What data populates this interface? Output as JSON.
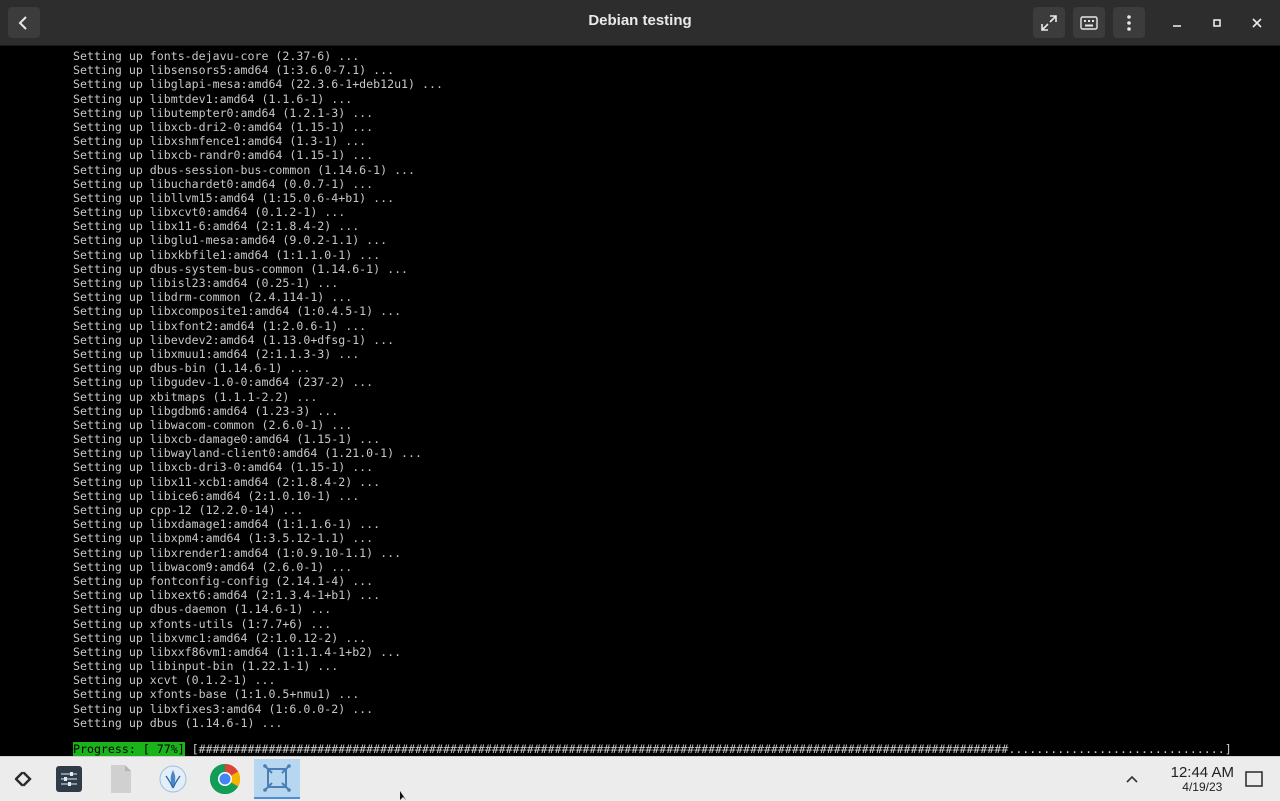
{
  "window": {
    "title": "Debian testing"
  },
  "terminal": {
    "lines": [
      "Setting up fonts-dejavu-core (2.37-6) ...",
      "Setting up libsensors5:amd64 (1:3.6.0-7.1) ...",
      "Setting up libglapi-mesa:amd64 (22.3.6-1+deb12u1) ...",
      "Setting up libmtdev1:amd64 (1.1.6-1) ...",
      "Setting up libutempter0:amd64 (1.2.1-3) ...",
      "Setting up libxcb-dri2-0:amd64 (1.15-1) ...",
      "Setting up libxshmfence1:amd64 (1.3-1) ...",
      "Setting up libxcb-randr0:amd64 (1.15-1) ...",
      "Setting up dbus-session-bus-common (1.14.6-1) ...",
      "Setting up libuchardet0:amd64 (0.0.7-1) ...",
      "Setting up libllvm15:amd64 (1:15.0.6-4+b1) ...",
      "Setting up libxcvt0:amd64 (0.1.2-1) ...",
      "Setting up libx11-6:amd64 (2:1.8.4-2) ...",
      "Setting up libglu1-mesa:amd64 (9.0.2-1.1) ...",
      "Setting up libxkbfile1:amd64 (1:1.1.0-1) ...",
      "Setting up dbus-system-bus-common (1.14.6-1) ...",
      "Setting up libisl23:amd64 (0.25-1) ...",
      "Setting up libdrm-common (2.4.114-1) ...",
      "Setting up libxcomposite1:amd64 (1:0.4.5-1) ...",
      "Setting up libxfont2:amd64 (1:2.0.6-1) ...",
      "Setting up libevdev2:amd64 (1.13.0+dfsg-1) ...",
      "Setting up libxmuu1:amd64 (2:1.1.3-3) ...",
      "Setting up dbus-bin (1.14.6-1) ...",
      "Setting up libgudev-1.0-0:amd64 (237-2) ...",
      "Setting up xbitmaps (1.1.1-2.2) ...",
      "Setting up libgdbm6:amd64 (1.23-3) ...",
      "Setting up libwacom-common (2.6.0-1) ...",
      "Setting up libxcb-damage0:amd64 (1.15-1) ...",
      "Setting up libwayland-client0:amd64 (1.21.0-1) ...",
      "Setting up libxcb-dri3-0:amd64 (1.15-1) ...",
      "Setting up libx11-xcb1:amd64 (2:1.8.4-2) ...",
      "Setting up libice6:amd64 (2:1.0.10-1) ...",
      "Setting up cpp-12 (12.2.0-14) ...",
      "Setting up libxdamage1:amd64 (1:1.1.6-1) ...",
      "Setting up libxpm4:amd64 (1:3.5.12-1.1) ...",
      "Setting up libxrender1:amd64 (1:0.9.10-1.1) ...",
      "Setting up libwacom9:amd64 (2.6.0-1) ...",
      "Setting up fontconfig-config (2.14.1-4) ...",
      "Setting up libxext6:amd64 (2:1.3.4-1+b1) ...",
      "Setting up dbus-daemon (1.14.6-1) ...",
      "Setting up xfonts-utils (1:7.7+6) ...",
      "Setting up libxvmc1:amd64 (2:1.0.12-2) ...",
      "Setting up libxxf86vm1:amd64 (1:1.1.4-1+b2) ...",
      "Setting up libinput-bin (1.22.1-1) ...",
      "Setting up xcvt (0.1.2-1) ...",
      "Setting up xfonts-base (1:1.0.5+nmu1) ...",
      "Setting up libxfixes3:amd64 (1:6.0.0-2) ...",
      "Setting up dbus (1.14.6-1) ..."
    ],
    "progress_label": "Progress: [ 77%]",
    "progress_bar": "[####################################################################################################################...............................]",
    "progress_fraction": 0.77
  },
  "taskbar": {
    "clock_time": "12:44 AM",
    "clock_date": "4/19/23",
    "items": [
      {
        "icon": "app-launcher-icon"
      },
      {
        "icon": "settings-icon"
      },
      {
        "icon": "files-icon"
      },
      {
        "icon": "discover-icon"
      },
      {
        "icon": "chrome-icon"
      },
      {
        "icon": "terminal-window-icon"
      }
    ]
  },
  "colors": {
    "titlebar": "#2d2d2d",
    "terminal_bg": "#000000",
    "terminal_text": "#c8c8c8",
    "progress_green": "#1ab31a",
    "taskbar": "#ececec",
    "active_task": "#b7d6ef"
  }
}
